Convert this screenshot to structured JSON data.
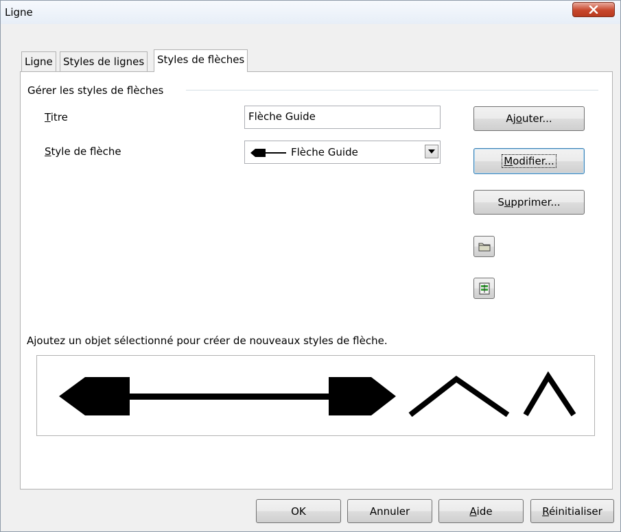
{
  "window": {
    "title": "Ligne"
  },
  "tabs": [
    {
      "label": "Ligne",
      "active": false
    },
    {
      "label": "Styles de lignes",
      "active": false
    },
    {
      "label": "Styles de flèches",
      "active": true
    }
  ],
  "group": {
    "title": "Gérer les styles de flèches"
  },
  "form": {
    "title_label_u": "T",
    "title_label_rest": "itre",
    "title_value": "Flèche Guide",
    "style_label_u": "S",
    "style_label_rest": "tyle de flèche",
    "style_value": "Flèche Guide"
  },
  "side_buttons": {
    "add_pre": "Aj",
    "add_u": "o",
    "add_post": "uter...",
    "modify_u": "M",
    "modify_post": "odifier...",
    "delete_pre": "S",
    "delete_u": "u",
    "delete_post": "pprimer...",
    "load_icon": "folder-icon",
    "save_icon": "save-arrow-styles-icon"
  },
  "hint": "Ajoutez un objet sélectionné pour créer de nouveaux styles de flèche.",
  "bottom_buttons": {
    "ok": "OK",
    "cancel": "Annuler",
    "help_u": "A",
    "help_post": "ide",
    "reset_u": "R",
    "reset_post": "éinitialiser"
  },
  "colors": {
    "accent_focus": "#3c7fb1",
    "close_red": "#c7472c"
  }
}
